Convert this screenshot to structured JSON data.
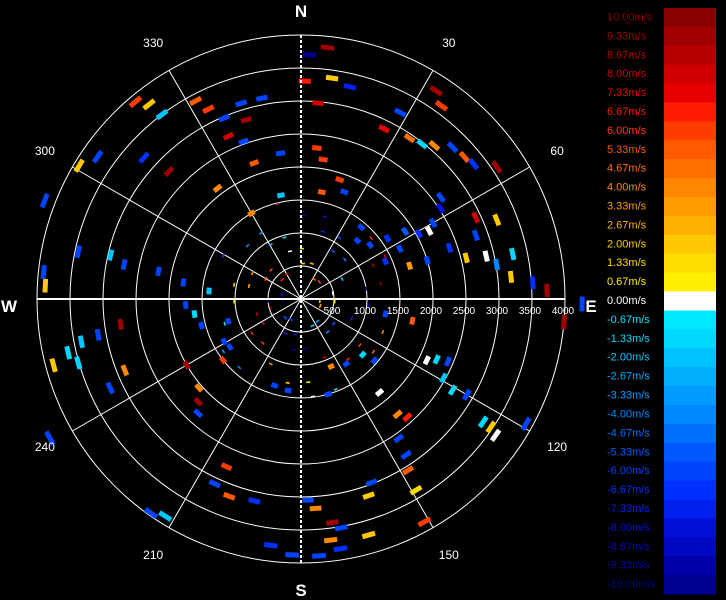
{
  "chart_data": {
    "type": "polar-scatter",
    "title": "",
    "cardinals": {
      "north": "N",
      "south": "S",
      "east": "E",
      "west": "W"
    },
    "angle_labels": [
      {
        "deg": 30,
        "label": "30"
      },
      {
        "deg": 60,
        "label": "60"
      },
      {
        "deg": 120,
        "label": "120"
      },
      {
        "deg": 150,
        "label": "150"
      },
      {
        "deg": 210,
        "label": "210"
      },
      {
        "deg": 240,
        "label": "240"
      },
      {
        "deg": 300,
        "label": "300"
      },
      {
        "deg": 330,
        "label": "330"
      }
    ],
    "range_rings": [
      500,
      1000,
      1500,
      2000,
      2500,
      3000,
      3500,
      4000
    ],
    "range_labels": [
      "500",
      "1000",
      "1500",
      "2000",
      "2500",
      "3000",
      "3500",
      "4000"
    ],
    "range_max": 4000,
    "legend": {
      "labels": [
        "10.00m/s",
        "9.33m/s",
        "8.67m/s",
        "8.00m/s",
        "7.33m/s",
        "6.67m/s",
        "6.00m/s",
        "5.33m/s",
        "4.67m/s",
        "4.00m/s",
        "3.33m/s",
        "2.67m/s",
        "2.00m/s",
        "1.33m/s",
        "0.67m/s",
        "0.00m/s",
        "-0.67m/s",
        "-1.33m/s",
        "-2.00m/s",
        "-2.67m/s",
        "-3.33m/s",
        "-4.00m/s",
        "-4.67m/s",
        "-5.33m/s",
        "-6.00m/s",
        "-6.67m/s",
        "-7.33m/s",
        "-8.00m/s",
        "-8.67m/s",
        "-9.33m/s",
        "-10.00m/s"
      ],
      "colors": [
        "#8b0000",
        "#a00000",
        "#b80000",
        "#d00000",
        "#e80000",
        "#ff1a00",
        "#ff3c00",
        "#ff5a00",
        "#ff7000",
        "#ff8800",
        "#ff9c00",
        "#ffb000",
        "#ffc800",
        "#ffdc00",
        "#ffee00",
        "#ffffff",
        "#00e8ff",
        "#00d8ff",
        "#00c4ff",
        "#00b0ff",
        "#009cff",
        "#0088ff",
        "#0070ff",
        "#0058ff",
        "#0044ff",
        "#0030ff",
        "#0020f0",
        "#0010d8",
        "#0008c0",
        "#0000a8",
        "#000090"
      ]
    },
    "points": [
      {
        "az": 2,
        "r": 3700,
        "v": -10.0
      },
      {
        "az": 6,
        "r": 3830,
        "v": 9.33
      },
      {
        "az": 8,
        "r": 3380,
        "v": 2.0
      },
      {
        "az": 13,
        "r": 3300,
        "v": -7.33
      },
      {
        "az": 1,
        "r": 3300,
        "v": 6.67
      },
      {
        "az": 5,
        "r": 2980,
        "v": 8.0
      },
      {
        "az": 6,
        "r": 2300,
        "v": 6.0
      },
      {
        "az": 9,
        "r": 2140,
        "v": 6.0
      },
      {
        "az": 28,
        "r": 3200,
        "v": -6.0
      },
      {
        "az": 26,
        "r": 2870,
        "v": 7.33
      },
      {
        "az": 33,
        "r": 3760,
        "v": 9.33
      },
      {
        "az": 36,
        "r": 3620,
        "v": 6.0
      },
      {
        "az": 34,
        "r": 2940,
        "v": 4.67
      },
      {
        "az": 38,
        "r": 2980,
        "v": -1.33
      },
      {
        "az": 41,
        "r": 3080,
        "v": 4.0
      },
      {
        "az": 45,
        "r": 3250,
        "v": -6.0
      },
      {
        "az": 49,
        "r": 3280,
        "v": 5.33
      },
      {
        "az": 52,
        "r": 3320,
        "v": -6.67
      },
      {
        "az": 56,
        "r": 3580,
        "v": 9.33
      },
      {
        "az": 54,
        "r": 2620,
        "v": -6.0
      },
      {
        "az": 57,
        "r": 2520,
        "v": -8.0
      },
      {
        "az": 60,
        "r": 2310,
        "v": -6.0
      },
      {
        "az": 61,
        "r": 2040,
        "v": -6.67
      },
      {
        "az": 63,
        "r": 1680,
        "v": -6.0
      },
      {
        "az": 66,
        "r": 1400,
        "v": -6.67
      },
      {
        "az": 57,
        "r": 1880,
        "v": -5.33
      },
      {
        "az": 55,
        "r": 1600,
        "v": -6.67
      },
      {
        "az": 52,
        "r": 1330,
        "v": -6.0
      },
      {
        "az": 62,
        "r": 2200,
        "v": 0.0
      },
      {
        "az": 65,
        "r": 2920,
        "v": 8.0
      },
      {
        "az": 68,
        "r": 3200,
        "v": 2.0
      },
      {
        "az": 70,
        "r": 2820,
        "v": -6.0
      },
      {
        "az": 71,
        "r": 2380,
        "v": -6.67
      },
      {
        "az": 73,
        "r": 2000,
        "v": -6.0
      },
      {
        "az": 73,
        "r": 1720,
        "v": 3.33
      },
      {
        "az": 76,
        "r": 2580,
        "v": 2.0
      },
      {
        "az": 77,
        "r": 2880,
        "v": 0.0
      },
      {
        "az": 78,
        "r": 3280,
        "v": -1.33
      },
      {
        "az": 86,
        "r": 3520,
        "v": -6.67
      },
      {
        "az": 88,
        "r": 3730,
        "v": 9.33
      },
      {
        "az": 84,
        "r": 3200,
        "v": 2.0
      },
      {
        "az": 80,
        "r": 3010,
        "v": -4.0
      },
      {
        "az": 91,
        "r": 4260,
        "v": -6.0
      },
      {
        "az": 95,
        "r": 4000,
        "v": 9.33
      },
      {
        "az": 114,
        "r": 2250,
        "v": -1.33
      },
      {
        "az": 116,
        "r": 2120,
        "v": 0.0
      },
      {
        "az": 119,
        "r": 2470,
        "v": -2.0
      },
      {
        "az": 121,
        "r": 2680,
        "v": -1.33
      },
      {
        "az": 124,
        "r": 3330,
        "v": -1.33
      },
      {
        "az": 124,
        "r": 3470,
        "v": 2.0
      },
      {
        "az": 125,
        "r": 3600,
        "v": 0.0
      },
      {
        "az": 113,
        "r": 2420,
        "v": -6.0
      },
      {
        "az": 120,
        "r": 2900,
        "v": -6.0
      },
      {
        "az": 130,
        "r": 1450,
        "v": -6.0
      },
      {
        "az": 138,
        "r": 2410,
        "v": 6.67
      },
      {
        "az": 140,
        "r": 2280,
        "v": 4.0
      },
      {
        "az": 145,
        "r": 2580,
        "v": -6.0
      },
      {
        "az": 146,
        "r": 2850,
        "v": -6.0
      },
      {
        "az": 148,
        "r": 3060,
        "v": 5.33
      },
      {
        "az": 149,
        "r": 3380,
        "v": 1.33
      },
      {
        "az": 151,
        "r": 3860,
        "v": 6.0
      },
      {
        "az": 140,
        "r": 1850,
        "v": 0.0
      },
      {
        "az": 145,
        "r": 1200,
        "v": -6.0
      },
      {
        "az": 159,
        "r": 2980,
        "v": -6.0
      },
      {
        "az": 161,
        "r": 3150,
        "v": 2.0
      },
      {
        "az": 164,
        "r": 3720,
        "v": 2.0
      },
      {
        "az": 176,
        "r": 3900,
        "v": -6.0
      },
      {
        "az": 171,
        "r": 3830,
        "v": -6.67
      },
      {
        "az": 173,
        "r": 3680,
        "v": 4.0
      },
      {
        "az": 170,
        "r": 3520,
        "v": -6.0
      },
      {
        "az": 172,
        "r": 3420,
        "v": 9.33
      },
      {
        "az": 176,
        "r": 3180,
        "v": 4.0
      },
      {
        "az": 178,
        "r": 3050,
        "v": -6.0
      },
      {
        "az": 182,
        "r": 3880,
        "v": -6.0
      },
      {
        "az": 187,
        "r": 3760,
        "v": -6.67
      },
      {
        "az": 193,
        "r": 3140,
        "v": -6.67
      },
      {
        "az": 200,
        "r": 3180,
        "v": 5.33
      },
      {
        "az": 204,
        "r": 2780,
        "v": 6.0
      },
      {
        "az": 205,
        "r": 3090,
        "v": -6.0
      },
      {
        "az": 212,
        "r": 3880,
        "v": -2.0
      },
      {
        "az": 215,
        "r": 3960,
        "v": -6.0
      },
      {
        "az": 222,
        "r": 2330,
        "v": -6.0
      },
      {
        "az": 225,
        "r": 2200,
        "v": 9.33
      },
      {
        "az": 229,
        "r": 2050,
        "v": 4.0
      },
      {
        "az": 240,
        "r": 2000,
        "v": 9.33
      },
      {
        "az": 241,
        "r": 1330,
        "v": -6.0
      },
      {
        "az": 245,
        "r": 3190,
        "v": -6.0
      },
      {
        "az": 248,
        "r": 2880,
        "v": 4.0
      },
      {
        "az": 254,
        "r": 3510,
        "v": -1.33
      },
      {
        "az": 255,
        "r": 3880,
        "v": 2.0
      },
      {
        "az": 257,
        "r": 3620,
        "v": -1.33
      },
      {
        "az": 259,
        "r": 3390,
        "v": -2.0
      },
      {
        "az": 260,
        "r": 3120,
        "v": -6.0
      },
      {
        "az": 262,
        "r": 2760,
        "v": 9.33
      },
      {
        "az": 267,
        "r": 1750,
        "v": -6.0
      },
      {
        "az": 262,
        "r": 1630,
        "v": -1.33
      },
      {
        "az": 255,
        "r": 1560,
        "v": -6.0
      },
      {
        "az": 253,
        "r": 1150,
        "v": -6.0
      },
      {
        "az": 241,
        "r": 4350,
        "v": -6.0
      },
      {
        "az": 273,
        "r": 3880,
        "v": 2.0
      },
      {
        "az": 276,
        "r": 3920,
        "v": -6.0
      },
      {
        "az": 282,
        "r": 3450,
        "v": -6.0
      },
      {
        "az": 283,
        "r": 2960,
        "v": -2.0
      },
      {
        "az": 281,
        "r": 2730,
        "v": -6.0
      },
      {
        "az": 281,
        "r": 2200,
        "v": -6.0
      },
      {
        "az": 275,
        "r": 1400,
        "v": -2.0
      },
      {
        "az": 278,
        "r": 1800,
        "v": -6.0
      },
      {
        "az": 291,
        "r": 4160,
        "v": -6.0
      },
      {
        "az": 301,
        "r": 3920,
        "v": 2.0
      },
      {
        "az": 305,
        "r": 3760,
        "v": -6.0
      },
      {
        "az": 312,
        "r": 3200,
        "v": -6.67
      },
      {
        "az": 314,
        "r": 2780,
        "v": 9.33
      },
      {
        "az": 320,
        "r": 3900,
        "v": 6.0
      },
      {
        "az": 322,
        "r": 3740,
        "v": 2.0
      },
      {
        "az": 323,
        "r": 3500,
        "v": -2.0
      },
      {
        "az": 332,
        "r": 3400,
        "v": 5.33
      },
      {
        "az": 334,
        "r": 3200,
        "v": 6.0
      },
      {
        "az": 337,
        "r": 2980,
        "v": -6.0
      },
      {
        "az": 340,
        "r": 2540,
        "v": -6.0
      },
      {
        "az": 343,
        "r": 3100,
        "v": -6.0
      },
      {
        "az": 349,
        "r": 3100,
        "v": -6.0
      },
      {
        "az": 343,
        "r": 2840,
        "v": 9.33
      },
      {
        "az": 336,
        "r": 2700,
        "v": 8.0
      },
      {
        "az": 341,
        "r": 2180,
        "v": 5.33
      },
      {
        "az": 352,
        "r": 2230,
        "v": -6.0
      },
      {
        "az": 330,
        "r": 1500,
        "v": 4.0
      },
      {
        "az": 323,
        "r": 2100,
        "v": 4.0
      },
      {
        "az": 349,
        "r": 1600,
        "v": -2.0
      },
      {
        "az": 11,
        "r": 1650,
        "v": 5.33
      },
      {
        "az": 18,
        "r": 1900,
        "v": 6.0
      },
      {
        "az": 22,
        "r": 1750,
        "v": -6.0
      },
      {
        "az": 40,
        "r": 1420,
        "v": -6.0
      },
      {
        "az": 44,
        "r": 1230,
        "v": -6.0
      },
      {
        "az": 100,
        "r": 1300,
        "v": -6.0
      },
      {
        "az": 101,
        "r": 1720,
        "v": 5.33
      },
      {
        "az": 197,
        "r": 1370,
        "v": -6.0
      },
      {
        "az": 188,
        "r": 1400,
        "v": -6.0
      },
      {
        "az": 164,
        "r": 1500,
        "v": -6.0
      },
      {
        "az": 156,
        "r": 1120,
        "v": 4.0
      },
      {
        "az": 132,
        "r": 1260,
        "v": -1.33
      },
      {
        "az": 232,
        "r": 1500,
        "v": 6.0
      },
      {
        "az": 236,
        "r": 1300,
        "v": -6.0
      },
      {
        "az": 119,
        "r": 3900,
        "v": -6.0
      }
    ]
  }
}
